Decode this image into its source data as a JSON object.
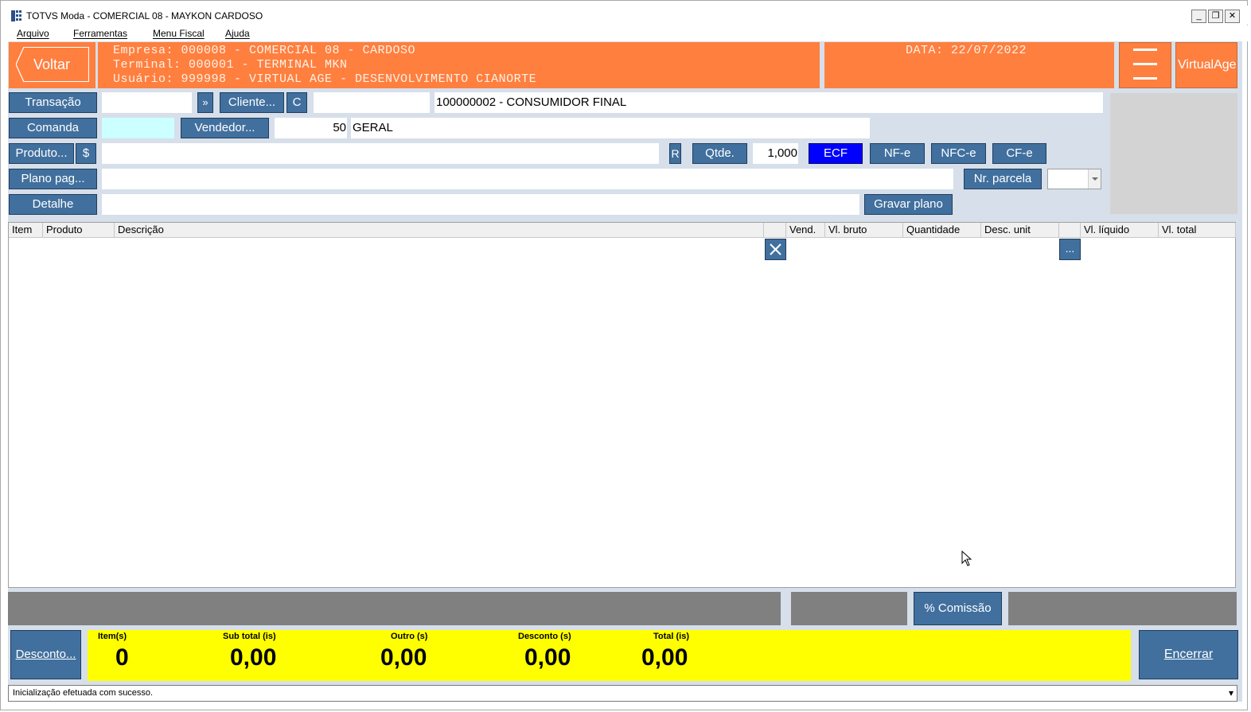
{
  "window": {
    "title": "TOTVS Moda - COMERCIAL 08 - MAYKON CARDOSO",
    "min_glyph": "_",
    "max_glyph": "❐",
    "close_glyph": "✕"
  },
  "menu": [
    "Arquivo",
    "Ferramentas",
    "Menu Fiscal",
    "Ajuda"
  ],
  "header": {
    "back_label": "Voltar",
    "empresa": "Empresa: 000008 - COMERCIAL 08 - CARDOSO",
    "terminal": "Terminal: 000001 - TERMINAL MKN",
    "usuario": "Usuário: 999998 - VIRTUAL AGE - DESENVOLVIMENTO CIANORTE",
    "date": "DATA: 22/07/2022",
    "brand": "VirtualAge",
    "accent_color": "#ff7f3f"
  },
  "form": {
    "transacao_label": "Transação",
    "transacao_value": "",
    "next_label": "»",
    "cliente_label": "Cliente...",
    "c_label": "C",
    "cliente_code": "",
    "cliente_name": "100000002 - CONSUMIDOR FINAL",
    "comanda_label": "Comanda",
    "comanda_value": "",
    "vendedor_label": "Vendedor...",
    "vendedor_code": "50",
    "vendedor_name": "GERAL",
    "produto_label": "Produto...",
    "dollar_label": "$",
    "produto_value": "",
    "r_label": "R",
    "qtde_label": "Qtde.",
    "qtde_value": "1,000",
    "ecf_label": "ECF",
    "nfe_label": "NF-e",
    "nfce_label": "NFC-e",
    "cfe_label": "CF-e",
    "plano_label": "Plano pag...",
    "plano_value": "",
    "nr_parcela_label": "Nr. parcela",
    "nr_parcela_value": "",
    "detalhe_label": "Detalhe",
    "detalhe_value": "",
    "gravar_label": "Gravar plano",
    "selected_doc_color": "#0000ff"
  },
  "grid": {
    "columns": [
      "Item",
      "Produto",
      "Descrição",
      "",
      "Vend.",
      "Vl. bruto",
      "Quantidade",
      "Desc. unit",
      "",
      "Vl. líquido",
      "Vl. total"
    ],
    "delete_glyph": "✕",
    "more_glyph": "..."
  },
  "comissao_label": "% Comissão",
  "footer": {
    "desconto_label": "Desconto...",
    "encerrar_label": "Encerrar",
    "totals": [
      {
        "label": "Item(s)",
        "value": "0"
      },
      {
        "label": "Sub total (is)",
        "value": "0,00"
      },
      {
        "label": "Outro (s)",
        "value": "0,00"
      },
      {
        "label": "Desconto (s)",
        "value": "0,00"
      },
      {
        "label": "Total (is)",
        "value": "0,00"
      }
    ],
    "totals_bg": "#ffff00"
  },
  "status": {
    "message": "Inicialização efetuada com sucesso.",
    "arrow": "▾"
  }
}
